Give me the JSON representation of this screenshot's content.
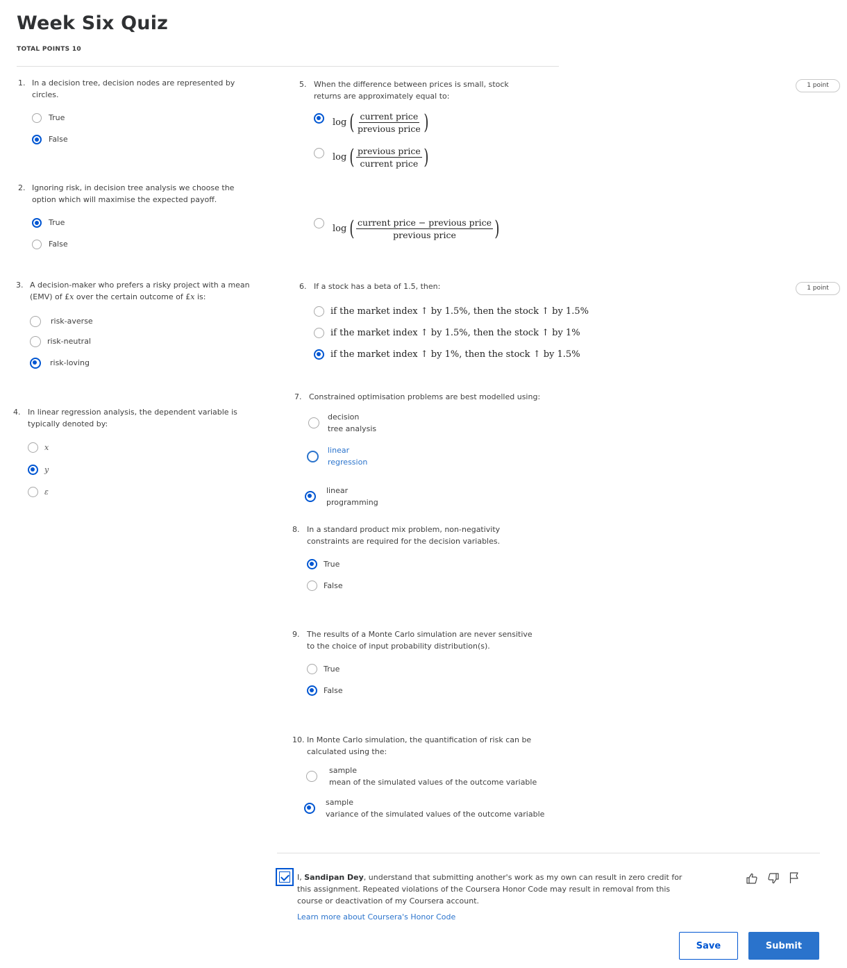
{
  "header": {
    "title": "Week Six Quiz",
    "total_points": "TOTAL POINTS 10"
  },
  "point_badge": "1 point",
  "questions": [
    {
      "num": "1.",
      "text": "In a decision tree, decision nodes are represented by circles.",
      "options": [
        "True",
        "False"
      ],
      "selected": 1
    },
    {
      "num": "2.",
      "text": "Ignoring risk, in decision tree analysis we choose the option which will maximise the expected payoff.",
      "options": [
        "True",
        "False"
      ],
      "selected": 0
    },
    {
      "num": "3.",
      "text_a": "A decision-maker who prefers a risky project with a mean (EMV) of £",
      "var_a": "x",
      "text_b": " over the certain outcome of £",
      "var_b": "x",
      "text_c": " is:",
      "options": [
        "risk-averse",
        "risk-neutral",
        "risk-loving"
      ],
      "selected": 2
    },
    {
      "num": "4.",
      "text": "In linear regression analysis, the dependent variable is typically denoted by:",
      "options": [
        "x",
        "y",
        "ε"
      ],
      "selected": 1
    },
    {
      "num": "5.",
      "text": "When the difference between prices is small, stock returns are approximately equal to:",
      "log": "log",
      "options": [
        {
          "num": "current price",
          "den": "previous price"
        },
        {
          "num": "previous price",
          "den": "current price"
        },
        {
          "num": "current price − previous price",
          "den": "previous price"
        }
      ],
      "selected": 0
    },
    {
      "num": "6.",
      "text": "If a stock has a beta of 1.5, then:",
      "options": [
        "if the market index ↑ by 1.5%, then the stock ↑ by 1.5%",
        "if the market index ↑ by 1.5%, then the stock ↑ by 1%",
        "if the market index ↑ by 1%, then the stock ↑ by 1.5%"
      ],
      "selected": 2
    },
    {
      "num": "7.",
      "text": "Constrained optimisation problems are best modelled using:",
      "options": [
        {
          "l1": "decision",
          "l2": "tree analysis"
        },
        {
          "l1": "linear",
          "l2": "regression"
        },
        {
          "l1": "linear",
          "l2": "programming"
        }
      ],
      "selected": 2
    },
    {
      "num": "8.",
      "text": "In a standard product mix problem, non-negativity constraints are required for the decision variables.",
      "options": [
        "True",
        "False"
      ],
      "selected": 0
    },
    {
      "num": "9.",
      "text": "The results of a Monte Carlo simulation are never sensitive to the choice of input probability distribution(s).",
      "options": [
        "True",
        "False"
      ],
      "selected": 1
    },
    {
      "num": "10.",
      "text": "In Monte Carlo simulation, the quantification of risk can be calculated using the:",
      "options": [
        {
          "l1": "sample",
          "l2": "mean of the simulated values of the outcome variable"
        },
        {
          "l1": "sample",
          "l2": "variance of the simulated values of the outcome variable"
        }
      ],
      "selected": 1
    }
  ],
  "honor": {
    "prefix": "I, ",
    "name": "Sandipan Dey",
    "rest": ", understand that submitting another's work as my own can result in zero credit for this assignment. Repeated violations of the Coursera Honor Code may result in removal from this course or deactivation of my Coursera account.",
    "learn_more": "Learn more about Coursera's Honor Code",
    "checked": true
  },
  "buttons": {
    "save": "Save",
    "submit": "Submit"
  },
  "icons": [
    "thumbs-up-icon",
    "thumbs-down-icon",
    "flag-icon"
  ],
  "colors": {
    "accent": "#0056d2",
    "link": "#2a73cc"
  }
}
